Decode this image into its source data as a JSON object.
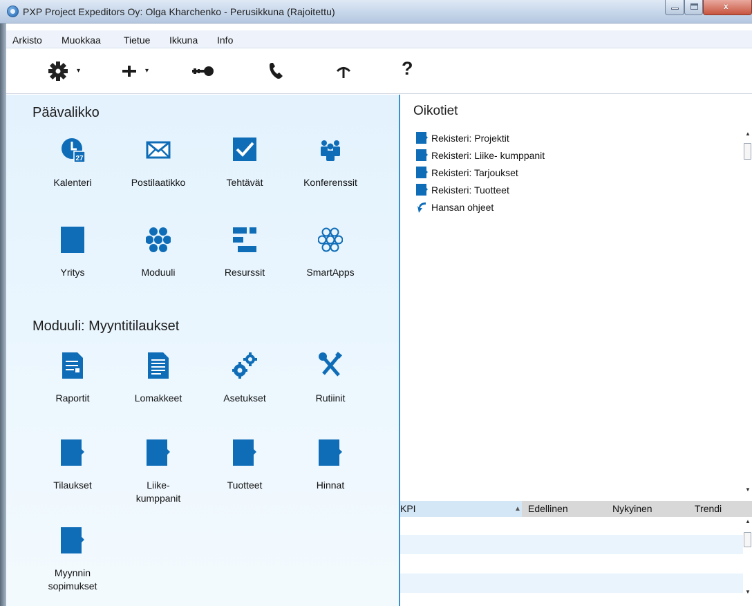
{
  "window": {
    "title": "PXP Project Expeditors Oy: Olga Kharchenko - Perusikkuna (Rajoitettu)",
    "controls": {
      "close": "x"
    }
  },
  "menubar": {
    "items": [
      {
        "label": "Arkisto"
      },
      {
        "label": "Muokkaa"
      },
      {
        "label": "Tietue"
      },
      {
        "label": "Ikkuna"
      },
      {
        "label": "Info"
      }
    ]
  },
  "toolbar": {
    "buttons": [
      {
        "icon": "gear-icon"
      },
      {
        "icon": "plus-icon"
      },
      {
        "icon": "key-icon"
      },
      {
        "icon": "phone-icon"
      },
      {
        "icon": "antenna-icon"
      },
      {
        "icon": "help-icon",
        "label": "?"
      }
    ],
    "dropdown_caret": "▾"
  },
  "main_menu": {
    "title": "Päävalikko",
    "items": [
      {
        "label": "Kalenteri",
        "icon": "calendar-icon",
        "badge": "27"
      },
      {
        "label": "Postilaatikko",
        "icon": "mail-icon"
      },
      {
        "label": "Tehtävät",
        "icon": "checkbox-icon"
      },
      {
        "label": "Konferenssit",
        "icon": "people-icon"
      },
      {
        "label": "Yritys",
        "icon": "book-icon"
      },
      {
        "label": "Moduuli",
        "icon": "hexagons-icon"
      },
      {
        "label": "Resurssit",
        "icon": "bars-icon"
      },
      {
        "label": "SmartApps",
        "icon": "hexagons-outline-icon"
      }
    ]
  },
  "module": {
    "title": "Moduuli:  Myyntitilaukset",
    "items": [
      {
        "label": "Raportit",
        "icon": "report-icon"
      },
      {
        "label": "Lomakkeet",
        "icon": "form-icon"
      },
      {
        "label": "Asetukset",
        "icon": "gears-icon"
      },
      {
        "label": "Rutiinit",
        "icon": "tools-icon"
      },
      {
        "label": "Tilaukset",
        "icon": "register-icon"
      },
      {
        "label": "Liike-\nkumppanit",
        "icon": "register-icon"
      },
      {
        "label": "Tuotteet",
        "icon": "register-icon"
      },
      {
        "label": "Hinnat",
        "icon": "register-icon"
      },
      {
        "label": "Myynnin\nsopimukset",
        "icon": "register-icon"
      }
    ]
  },
  "shortcuts": {
    "title": "Oikotiet",
    "items": [
      {
        "label": "Rekisteri: Projektit",
        "icon": "register-icon"
      },
      {
        "label": "Rekisteri: Liike- kumppanit",
        "icon": "register-icon"
      },
      {
        "label": "Rekisteri: Tarjoukset",
        "icon": "register-icon"
      },
      {
        "label": "Rekisteri: Tuotteet",
        "icon": "register-icon"
      },
      {
        "label": "Hansan ohjeet",
        "icon": "help-arrow-icon"
      }
    ]
  },
  "kpi": {
    "columns": [
      "KPI",
      "Edellinen",
      "Nykyinen",
      "Trendi"
    ],
    "sort_arrow": "▲",
    "rows": []
  },
  "colors": {
    "accent": "#0f6db8",
    "divider": "#3a8fd3",
    "left_bg": "#e3f2fd"
  }
}
